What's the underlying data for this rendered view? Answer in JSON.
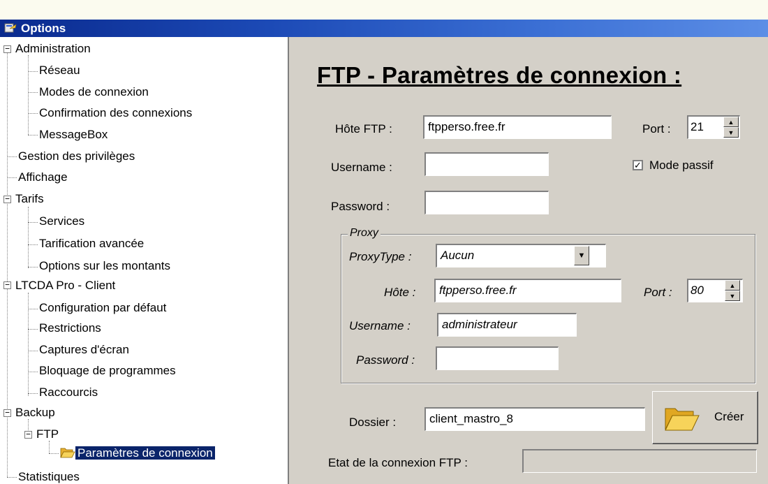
{
  "window": {
    "title": "Options"
  },
  "tree": {
    "administration": "Administration",
    "reseau": "Réseau",
    "modes": "Modes de connexion",
    "confirmation": "Confirmation des connexions",
    "messagebox": "MessageBox",
    "privileges": "Gestion des privilèges",
    "affichage": "Affichage",
    "tarifs": "Tarifs",
    "services": "Services",
    "tarification": "Tarification avancée",
    "options_montants": "Options sur les montants",
    "ltcda": "LTCDA Pro - Client",
    "config": "Configuration par défaut",
    "restrictions": "Restrictions",
    "captures": "Captures d'écran",
    "bloquage": "Bloquage de programmes",
    "raccourcis": "Raccourcis",
    "backup": "Backup",
    "ftp": "FTP",
    "params": "Paramètres de connexion",
    "statistiques": "Statistiques"
  },
  "panel": {
    "heading": "FTP - Paramètres de connexion :",
    "host_label": "Hôte FTP :",
    "host_value": "ftpperso.free.fr",
    "port_label": "Port :",
    "port_value": "21",
    "username_label": "Username :",
    "username_value": "",
    "password_label": "Password :",
    "password_value": "",
    "passive_label": "Mode passif",
    "passive_checked": true,
    "proxy": {
      "title": "Proxy",
      "type_label": "ProxyType :",
      "type_value": "Aucun",
      "host_label": "Hôte :",
      "host_value": "ftpperso.free.fr",
      "port_label": "Port :",
      "port_value": "80",
      "username_label": "Username :",
      "username_value": "administrateur",
      "password_label": "Password :",
      "password_value": ""
    },
    "folder_label": "Dossier :",
    "folder_value": "client_mastro_8",
    "create_label": "Créer",
    "status_label": "Etat de la connexion FTP :",
    "status_value": ""
  },
  "icons": {
    "window": "options-app-icon",
    "folder": "folder-icon",
    "open_folder": "open-folder-icon"
  }
}
